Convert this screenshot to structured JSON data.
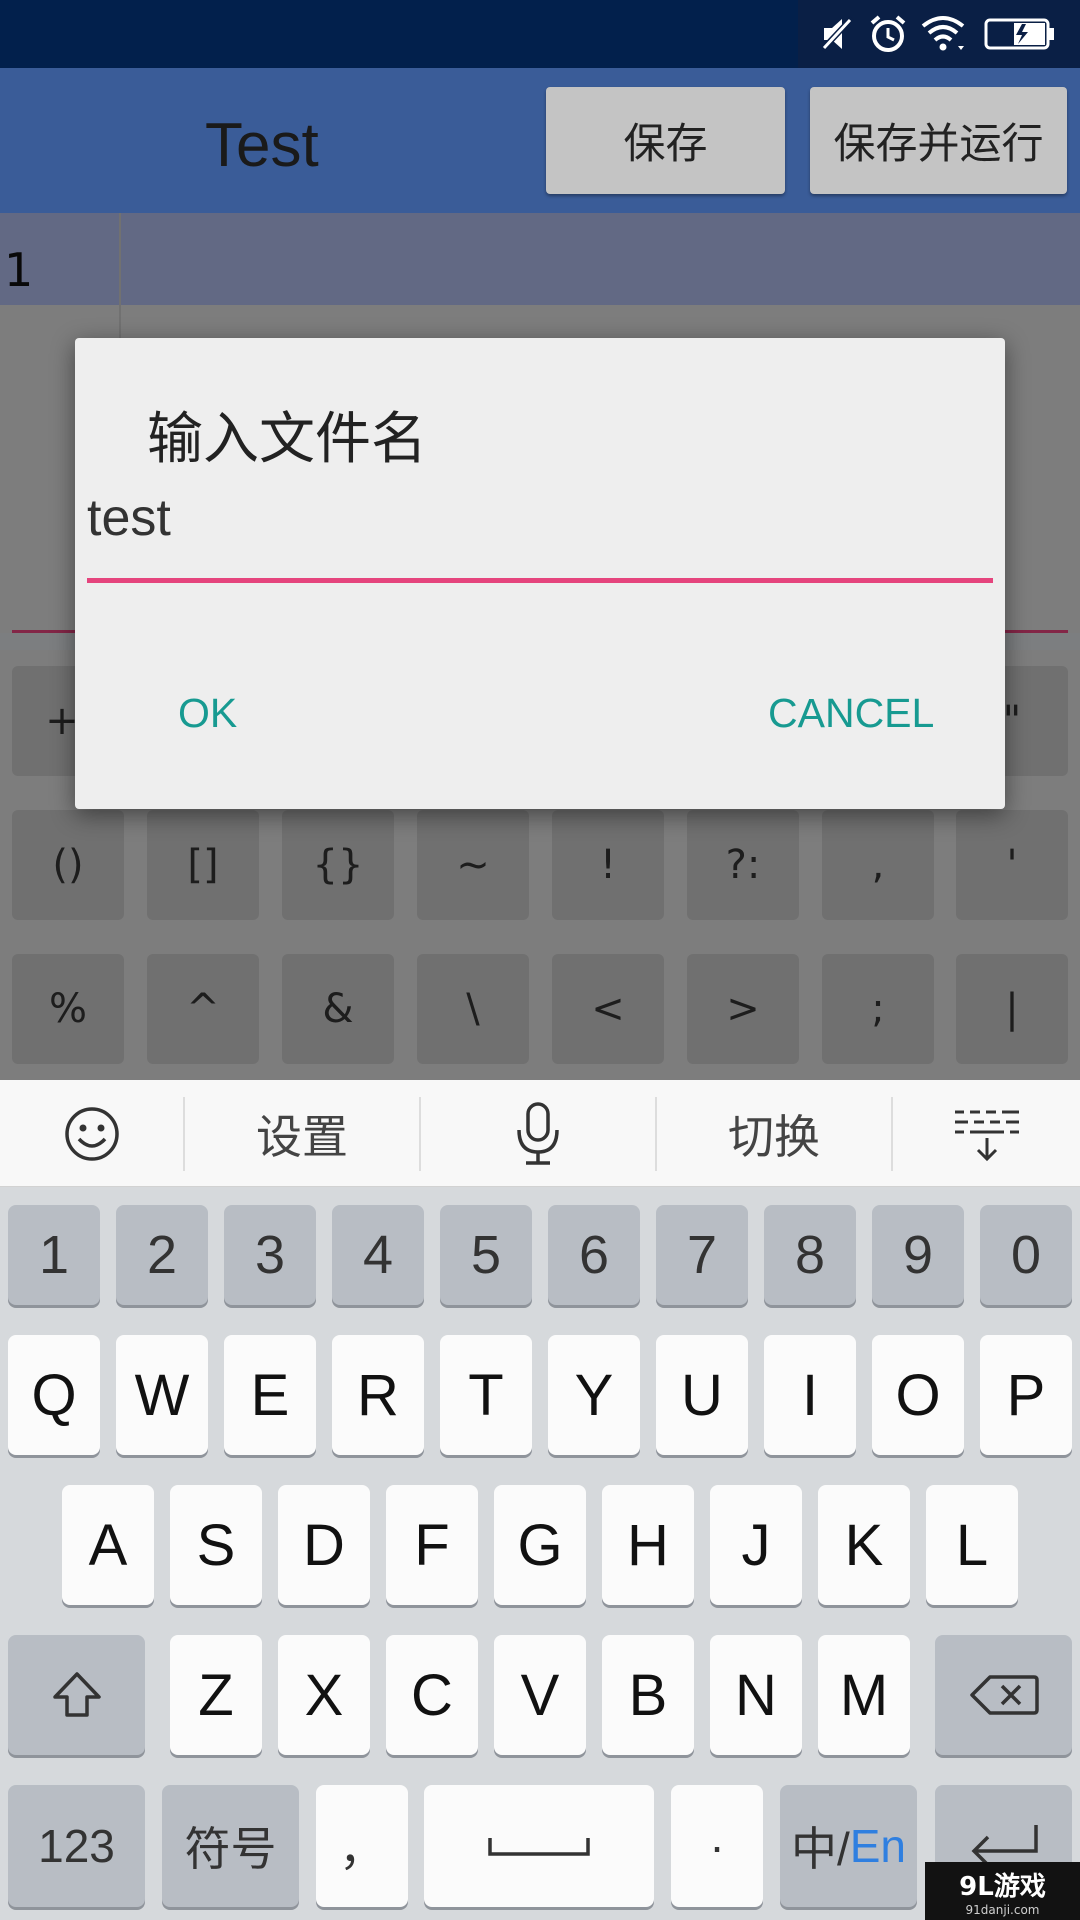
{
  "status_bar": {
    "icons": [
      "muted-sound-icon",
      "alarm-icon",
      "wifi-icon",
      "battery-charging-icon"
    ]
  },
  "app_bar": {
    "title": "Test",
    "save_label": "保存",
    "save_run_label": "保存并运行"
  },
  "editor": {
    "line_number": "1"
  },
  "symbol_keys": {
    "row1_left": "+",
    "row1_right": "\"",
    "row2": [
      "()",
      "[]",
      "{}",
      "~",
      "!",
      "?:",
      ",",
      "'"
    ],
    "row3": [
      "%",
      "^",
      "&",
      "\\",
      "<",
      ">",
      ";",
      "|"
    ]
  },
  "dialog": {
    "title": "输入文件名",
    "input_value": "test",
    "ok_label": "OK",
    "cancel_label": "CANCEL",
    "accent_color": "#e5447d",
    "button_color": "#179a91"
  },
  "ime_toolbar": {
    "emoji_icon": "emoji-icon",
    "settings_label": "设置",
    "mic_icon": "microphone-icon",
    "switch_label": "切换",
    "hide_icon": "hide-keyboard-icon"
  },
  "keyboard": {
    "numbers": [
      "1",
      "2",
      "3",
      "4",
      "5",
      "6",
      "7",
      "8",
      "9",
      "0"
    ],
    "row_q": [
      "Q",
      "W",
      "E",
      "R",
      "T",
      "Y",
      "U",
      "I",
      "O",
      "P"
    ],
    "row_a": [
      "A",
      "S",
      "D",
      "F",
      "G",
      "H",
      "J",
      "K",
      "L"
    ],
    "row_z": [
      "Z",
      "X",
      "C",
      "V",
      "B",
      "N",
      "M"
    ],
    "shift_icon": "shift-icon",
    "backspace_icon": "backspace-icon",
    "num_switch": "123",
    "symbols": "符号",
    "comma": "，",
    "space_icon": "space-icon",
    "period": "·",
    "lang_zh": "中/",
    "lang_en": "En",
    "enter_icon": "enter-icon"
  },
  "watermark": {
    "main": "9L游戏",
    "sub": "91danji.com"
  }
}
